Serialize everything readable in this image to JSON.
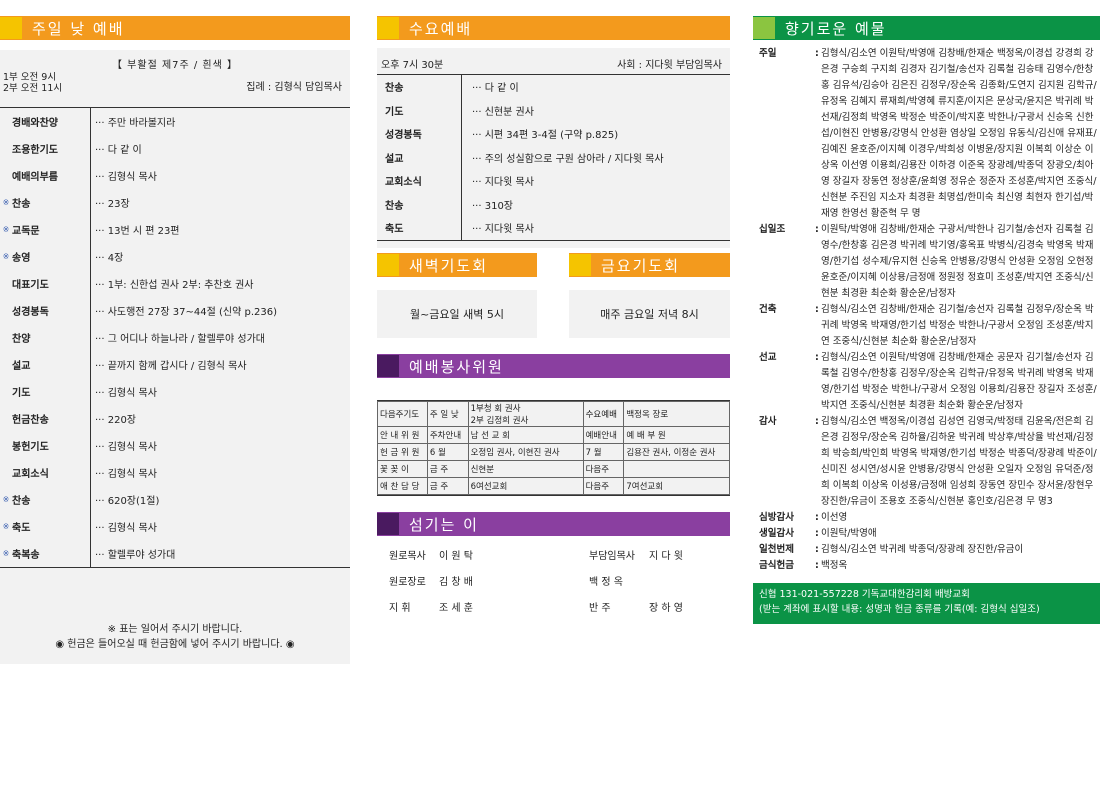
{
  "sunday": {
    "title": "주일 낮 예배",
    "week": "【 부활절 제7주 / 흰색 】",
    "time1": "1부 오전 9시",
    "time2": "2부 오전 11시",
    "presider": "집례 : 김형식 담임목사",
    "order": [
      {
        "mark": "",
        "label": "경배와찬양",
        "value": "··· 주만 바라볼지라"
      },
      {
        "mark": "",
        "label": "조용한기도",
        "value": "··· 다 같 이"
      },
      {
        "mark": "",
        "label": "예배의부름",
        "value": "··· 김형식 목사"
      },
      {
        "mark": "※",
        "label": "찬송",
        "value": "··· 23장"
      },
      {
        "mark": "※",
        "label": "교독문",
        "value": "··· 13번 시 편 23편"
      },
      {
        "mark": "※",
        "label": "송영",
        "value": "··· 4장"
      },
      {
        "mark": "",
        "label": "대표기도",
        "value": "··· 1부: 신한섭 권사          2부: 추찬호 권사"
      },
      {
        "mark": "",
        "label": "성경봉독",
        "value": "··· 사도행전 27장 37~44절 (신약 p.236)"
      },
      {
        "mark": "",
        "label": "찬양",
        "value": "··· 그 어디나 하늘나라 / 할렐루야 성가대"
      },
      {
        "mark": "",
        "label": "설교",
        "value": "··· 끝까지 함께 갑시다 / 김형식 목사"
      },
      {
        "mark": "",
        "label": "기도",
        "value": "··· 김형식 목사"
      },
      {
        "mark": "",
        "label": "헌금찬송",
        "value": "··· 220장"
      },
      {
        "mark": "",
        "label": "봉헌기도",
        "value": "··· 김형식 목사"
      },
      {
        "mark": "",
        "label": "교회소식",
        "value": "··· 김형식 목사"
      },
      {
        "mark": "※",
        "label": "찬송",
        "value": "··· 620장(1절)"
      },
      {
        "mark": "※",
        "label": "축도",
        "value": "··· 김형식 목사"
      },
      {
        "mark": "※",
        "label": "축복송",
        "value": "··· 할렐루야 성가대"
      }
    ],
    "note1": "※ 표는 일어서 주시기 바랍니다.",
    "note2": "◉  헌금은 들어오실 때 헌금함에 넣어 주시기 바랍니다.  ◉"
  },
  "wednesday": {
    "title": "수요예배",
    "time": "오후 7시 30분",
    "host": "사회 : 지다윗 부담임목사",
    "order": [
      {
        "label": "찬송",
        "value": "···  다 같 이"
      },
      {
        "label": "기도",
        "value": "···  신현분 권사"
      },
      {
        "label": "성경봉독",
        "value": "···  시편 34편 3-4절 (구약 p.825)"
      },
      {
        "label": "설교",
        "value": "···  주의 성실함으로 구원 삼아라 / 지다윗 목사"
      },
      {
        "label": "교회소식",
        "value": "···  지다윗 목사"
      },
      {
        "label": "찬송",
        "value": "···  310장"
      },
      {
        "label": "축도",
        "value": "···  지다윗 목사"
      }
    ]
  },
  "dawn": {
    "title": "새벽기도회",
    "text": "월~금요일 새벽 5시"
  },
  "friday": {
    "title": "금요기도회",
    "text": "매주 금요일 저녁 8시"
  },
  "service": {
    "title": "예배봉사위원",
    "rows": [
      [
        "다음주기도",
        "주 일 낮",
        "1부청  회 권사\n2부 김정희 권사",
        "수요예배",
        "백정옥 장로"
      ],
      [
        "안 내 위 원",
        "주차안내",
        "남 선 교 회",
        "예배안내",
        "예 배 부 원"
      ],
      [
        "헌 금 위 원",
        "6   월",
        "오정임 권사, 이현진 권사",
        "7   월",
        "김용잔 권사, 이정순 권사"
      ],
      [
        "꽃  꽂  이",
        "금   주",
        "신현분",
        "다음주",
        ""
      ],
      [
        "애 찬 담 당",
        "금   주",
        "6여선교회",
        "다음주",
        "7여선교회"
      ]
    ]
  },
  "workers": {
    "title": "섬기는 이",
    "rows": [
      [
        "원로목사",
        "이 원 탁",
        "부담임목사",
        "지 다 윗"
      ],
      [
        "원로장로",
        "김 창 배",
        "백 정 옥",
        ""
      ],
      [
        "지    휘",
        "조 세 훈",
        "반      주",
        "장 하 영"
      ]
    ]
  },
  "offering": {
    "title": "향기로운 예물",
    "items": [
      {
        "label": "주일",
        "value": "김형식/김소연 이원탁/박영애 김창배/한재순 백정옥/이경섭 강경희 강은경 구승희 구지희 김경자 김기철/송선자 김록철 김승태 김영수/한창홍 김유석/김승아 김은진 김정우/장순옥 김종화/도연지 김지원 김학규/유정옥 김혜지 류재희/박영혜 류지훈/이지은 문상국/윤지은 박귀례 박선재/김정희 박영옥 박정순 박준이/박지훈 박한나/구광서 신승옥 신한섭/이현진 안병용/강명식 안성환 염상일 오정임 유동식/김신애 유재표/김예진 윤호준/이지혜 이경우/박희성 이병윤/장지원 이복희 이상순 이상옥 이선영 이용희/김용잔 이하경 이준옥 장광례/박종덕 장광오/최아영 장길자 장동연 정상훈/윤희영 정유순 정준자 조성훈/박지연 조중식/신현분 주진임 지소자 최경환 최명섭/한미숙 최신영 최현자 한기섭/박재영 한영선 황준혁 무  명"
      },
      {
        "label": "십일조",
        "value": "이원탁/박영애 김창배/한재순 구광서/박한나 김기철/송선자 김록철 김영수/한창홍 김은경 박귀례 박기영/홍옥표 박병식/김경숙 박영옥 박재영/한기섭 성수제/유지현 신승옥 안병용/강명식 안성환 오정임 오현정 윤호준/이지혜 이상용/금정애 정원정 정효미 조성훈/박지연 조중식/신현분 최경환 최순화 황순운/남정자"
      },
      {
        "label": "건축",
        "value": "김형식/김소연 김창배/한재순 김기철/송선자 김록철 김정우/장순옥 박귀례 박영옥 박재영/한기섭 박정순 박한나/구광서 오정임 조성훈/박지연 조중식/신현분 최순화 황순운/남정자"
      },
      {
        "label": "선교",
        "value": "김형식/김소연 이원탁/박영애 김창배/한재순 공문자 김기철/송선자 김록철 김영수/한창홍 김정우/장순옥 김학규/유정옥 박귀례 박영옥 박재영/한기섭 박정순 박한나/구광서 오정임 이용희/김용잔 장길자 조성훈/박지연 조중식/신현분 최경환 최순화 황순운/남정자"
      },
      {
        "label": "감사",
        "value": "김형식/김소연 백정옥/이경섭 김성연 김영국/박정태 김윤옥/전은희 김은경 김정우/장순옥 김하율/김하윤 박귀례 박상후/박상율 박선재/김정희 박승희/박인희 박영옥 박재영/한기섭 박정순 박종덕/장광례 박준이/신미진 성시연/성시윤 안병용/강명식 안성환 오일자 오정임 유덕준/정  희 이복희 이상옥 이성용/금정애 임성희 장동연 장민수 장서윤/장현우 장진한/유금이 조용호 조중식/신현분 홍인호/김은경 무  명3"
      },
      {
        "label": "심방감사",
        "value": "이선영"
      },
      {
        "label": "생일감사",
        "value": "이원탁/박영애"
      },
      {
        "label": "일천번제",
        "value": "김형식/김소연 박귀례 박종덕/장광례 장진한/유금이"
      },
      {
        "label": "금식헌금",
        "value": "백정옥"
      }
    ],
    "bank1": "신협 131-021-557228 기독교대한감리회 배방교회",
    "bank2": "(받는 계좌에 표시할 내용: 성명과 헌금 종류를 기록(예: 김형식 십일조)"
  }
}
